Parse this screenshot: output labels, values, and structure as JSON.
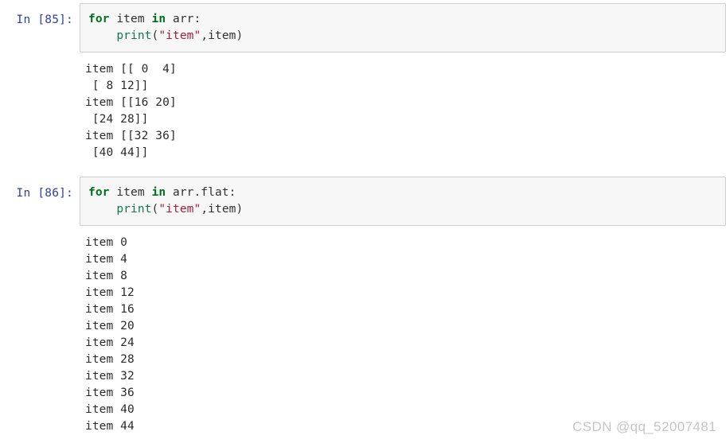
{
  "notebook": {
    "cells": [
      {
        "prompt": "In [85]:",
        "code": {
          "line1": {
            "kw_for": "for",
            "var": " item ",
            "kw_in": "in",
            "target": " arr:"
          },
          "line2": {
            "indent": "    ",
            "fn": "print",
            "open": "(",
            "str": "\"item\"",
            "comma": ",",
            "arg": "item",
            "close": ")"
          }
        },
        "output": [
          "item [[ 0  4]",
          " [ 8 12]]",
          "item [[16 20]",
          " [24 28]]",
          "item [[32 36]",
          " [40 44]]"
        ]
      },
      {
        "prompt": "In [86]:",
        "code": {
          "line1": {
            "kw_for": "for",
            "var": " item ",
            "kw_in": "in",
            "target": " arr.flat:"
          },
          "line2": {
            "indent": "    ",
            "fn": "print",
            "open": "(",
            "str": "\"item\"",
            "comma": ",",
            "arg": "item",
            "close": ")"
          }
        },
        "output": [
          "item 0",
          "item 4",
          "item 8",
          "item 12",
          "item 16",
          "item 20",
          "item 24",
          "item 28",
          "item 32",
          "item 36",
          "item 40",
          "item 44"
        ]
      }
    ]
  },
  "watermark": {
    "text": "CSDN @qq_52007481"
  },
  "colors": {
    "prompt": "#303f9f",
    "keyword": "#007020",
    "function": "#0e7a4e",
    "string": "#a11f3a",
    "cell_background": "#f7f7f7",
    "cell_border": "#cfcfcf",
    "output_text": "#2b2b2b",
    "watermark": "#c6c6c6"
  }
}
